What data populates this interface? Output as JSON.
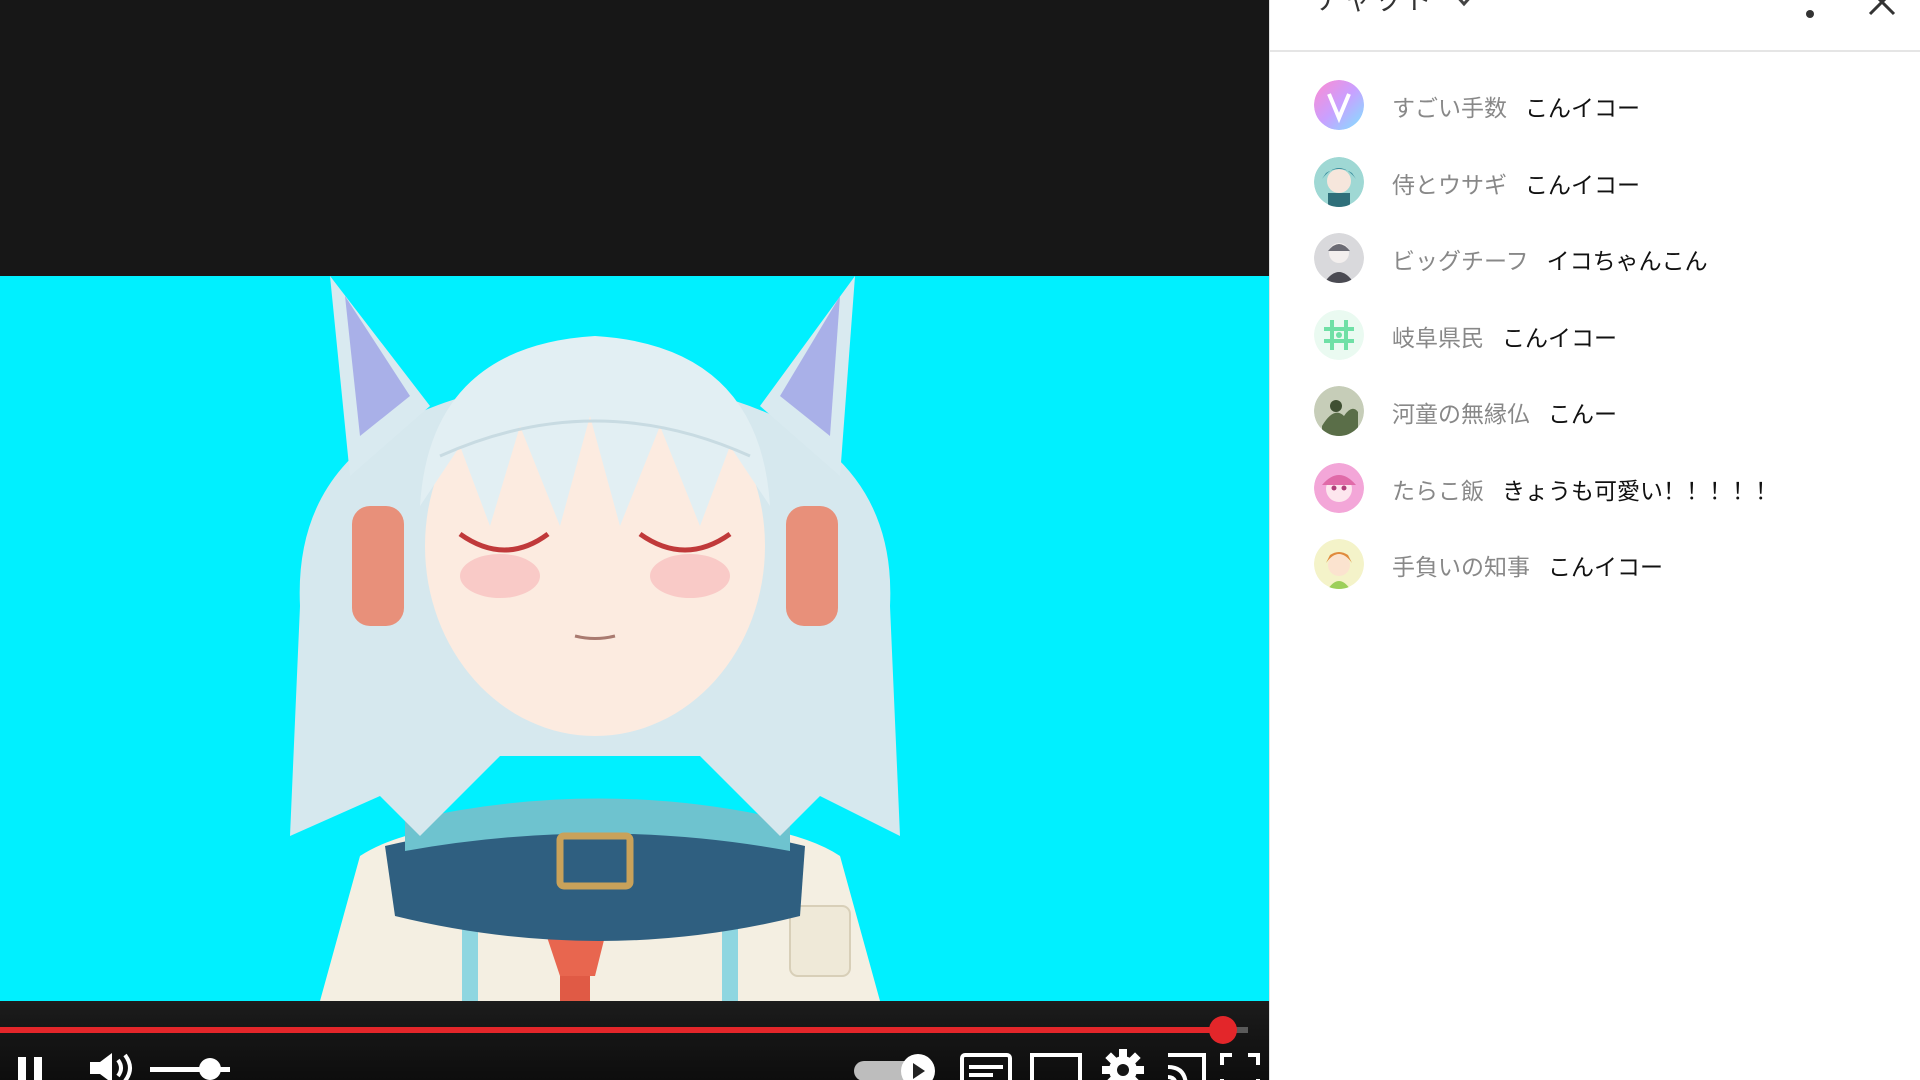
{
  "player": {
    "progress_fraction": 0.98,
    "volume_fraction": 0.75
  },
  "chat": {
    "title": "チャット",
    "messages": [
      {
        "author": "すごい手数",
        "text": "こんイコー",
        "avatar": "v-logo"
      },
      {
        "author": "侍とウサギ",
        "text": "こんイコー",
        "avatar": "teal-character"
      },
      {
        "author": "ビッグチーフ",
        "text": "イコちゃんこん",
        "avatar": "grey-character"
      },
      {
        "author": "岐阜県民",
        "text": "こんイコー",
        "avatar": "hash-glyph"
      },
      {
        "author": "河童の無縁仏",
        "text": "こんー",
        "avatar": "green-photo"
      },
      {
        "author": "たらこ飯",
        "text": "きょうも可愛い！！！！！",
        "avatar": "pink-character"
      },
      {
        "author": "手負いの知事",
        "text": "こんイコー",
        "avatar": "yellow-character"
      }
    ]
  },
  "colors": {
    "video_bg": "#00f0ff",
    "player_bg": "#171717",
    "progress": "#e3262a"
  }
}
